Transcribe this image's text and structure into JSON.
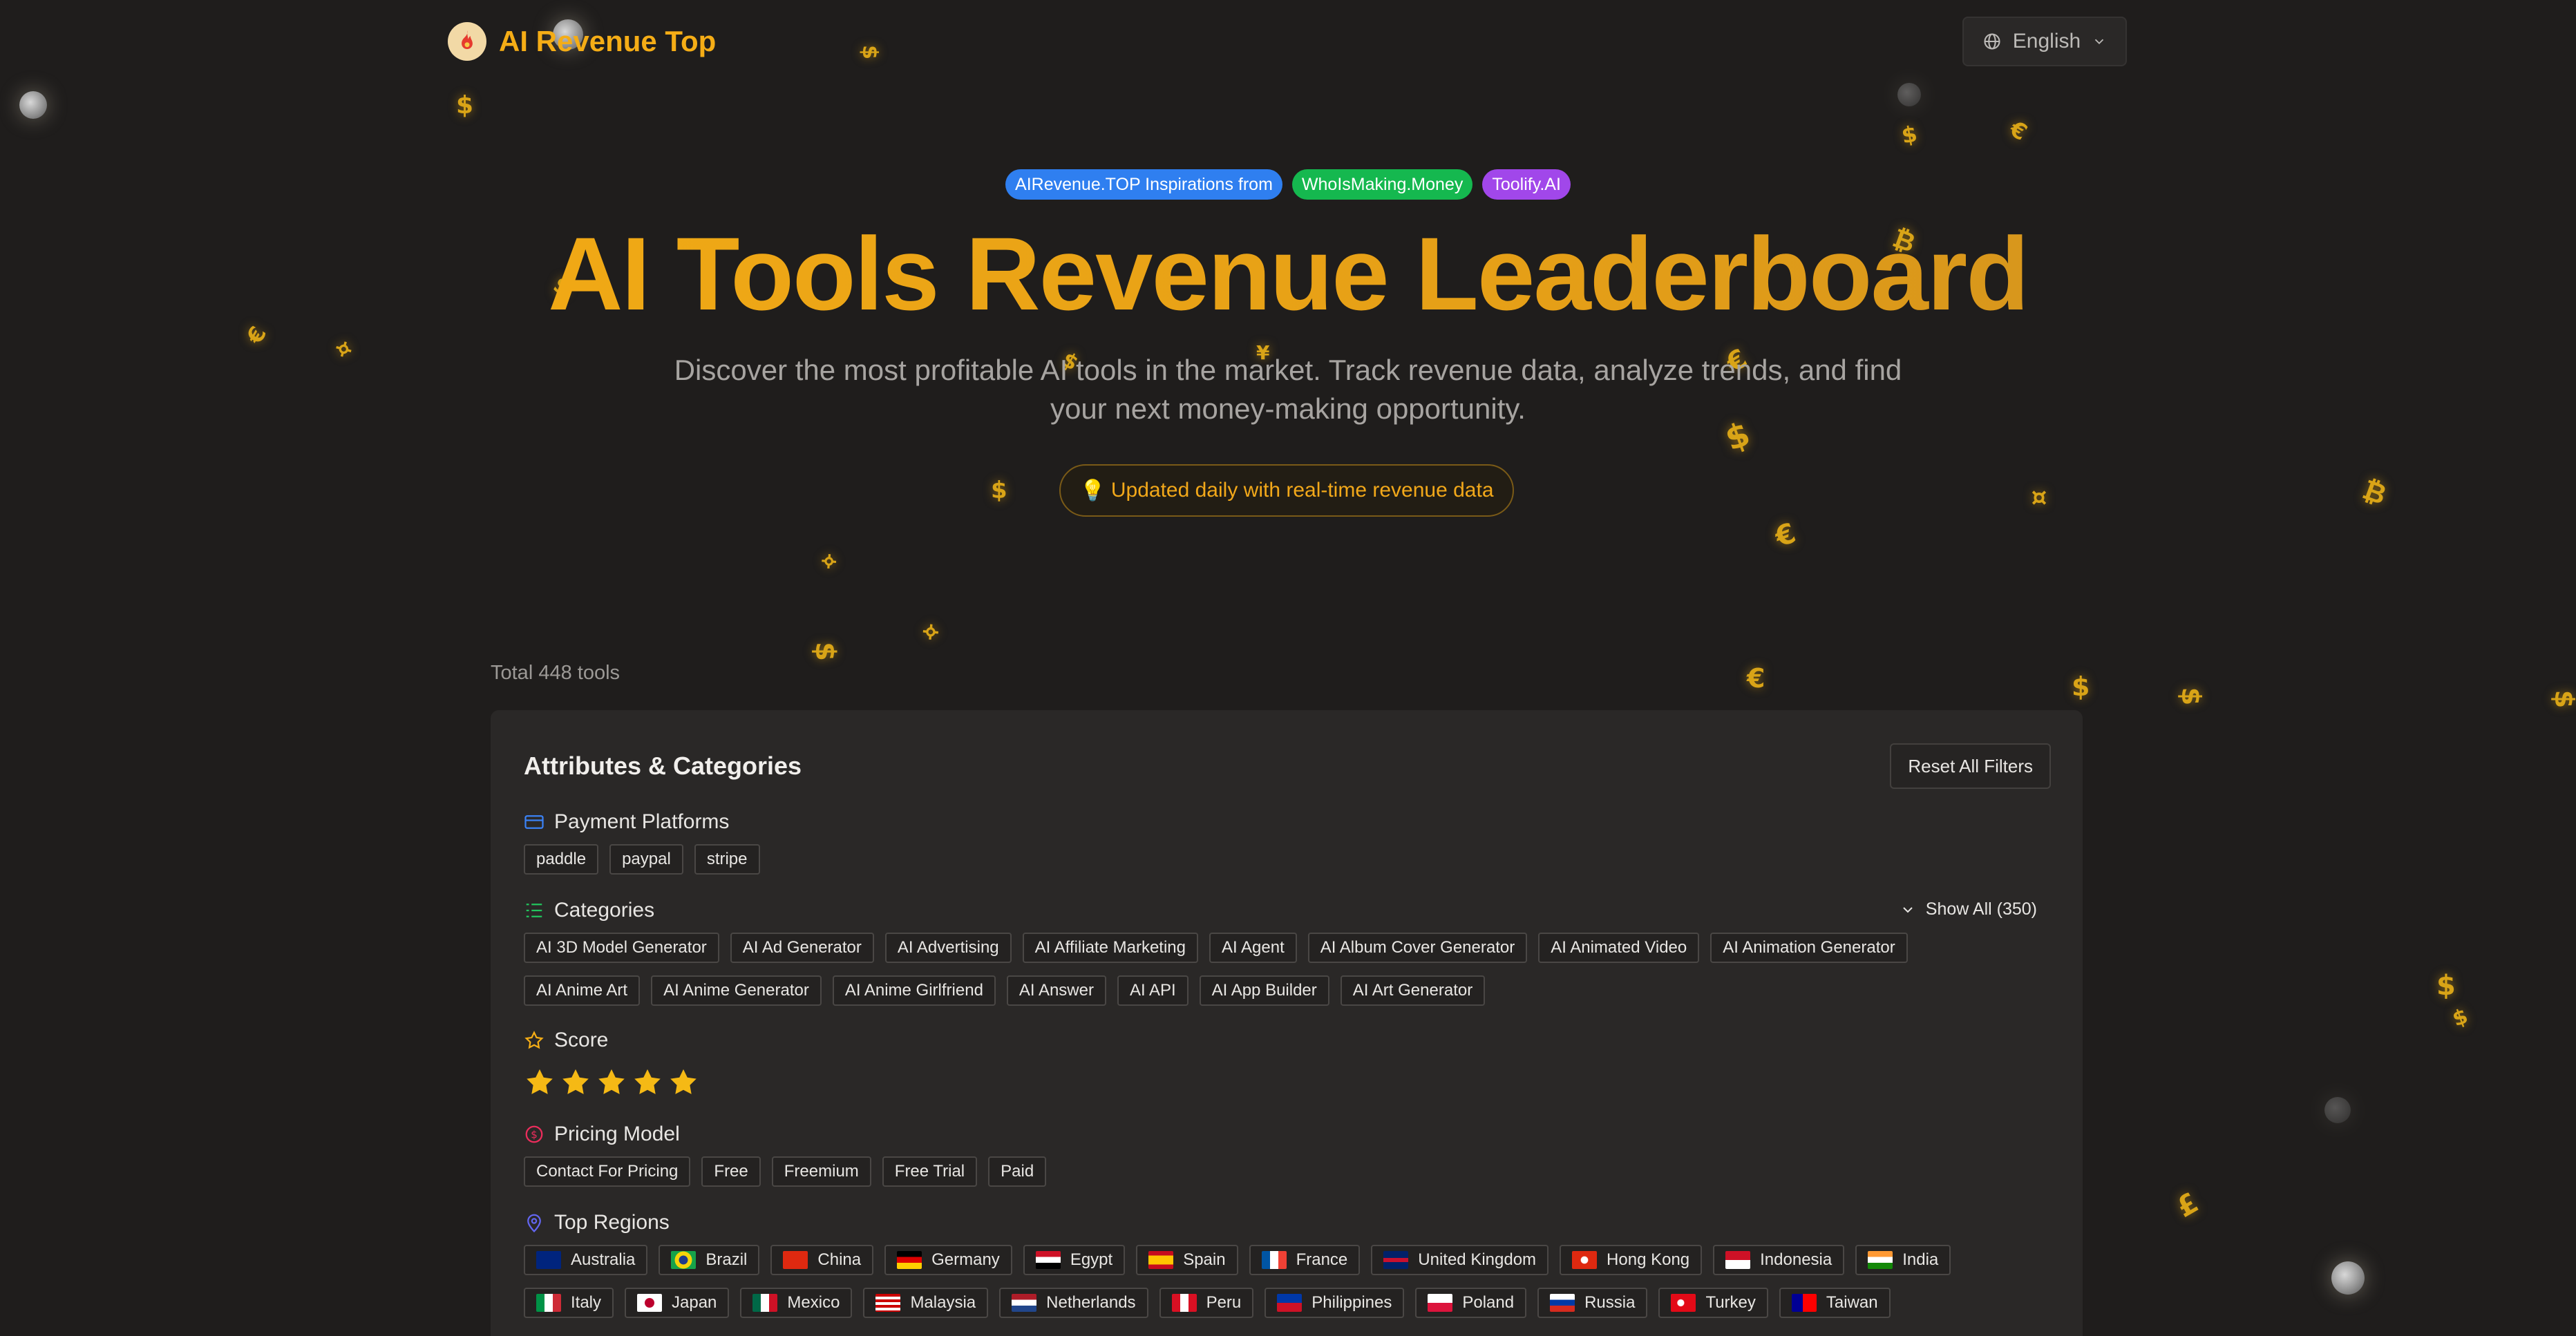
{
  "header": {
    "brand": "AI Revenue Top",
    "language": "English"
  },
  "hero": {
    "badges": [
      "AIRevenue.TOP Inspirations from",
      "WhoIsMaking.Money",
      "Toolify.AI"
    ],
    "title": "AI Tools Revenue Leaderboard",
    "subtitle": "Discover the most profitable AI tools in the market. Track revenue data, analyze trends, and find your next money-making opportunity.",
    "update_note": "Updated daily with real-time revenue data"
  },
  "total": "Total 448 tools",
  "filters": {
    "title": "Attributes & Categories",
    "reset": "Reset All Filters",
    "payment": {
      "title": "Payment Platforms",
      "items": [
        "paddle",
        "paypal",
        "stripe"
      ]
    },
    "categories": {
      "title": "Categories",
      "show_all": "Show All (350)",
      "items": [
        "AI 3D Model Generator",
        "AI Ad Generator",
        "AI Advertising",
        "AI Affiliate Marketing",
        "AI Agent",
        "AI Album Cover Generator",
        "AI Animated Video",
        "AI Animation Generator",
        "AI Anime Art",
        "AI Anime Generator",
        "AI Anime Girlfriend",
        "AI Answer",
        "AI API",
        "AI App Builder",
        "AI Art Generator"
      ]
    },
    "score": {
      "title": "Score",
      "stars": 5
    },
    "pricing": {
      "title": "Pricing Model",
      "items": [
        "Contact For Pricing",
        "Free",
        "Freemium",
        "Free Trial",
        "Paid"
      ]
    },
    "regions": {
      "title": "Top Regions",
      "items": [
        "Australia",
        "Brazil",
        "China",
        "Germany",
        "Egypt",
        "Spain",
        "France",
        "United Kingdom",
        "Hong Kong",
        "Indonesia",
        "India",
        "Italy",
        "Japan",
        "Mexico",
        "Malaysia",
        "Netherlands",
        "Peru",
        "Philippines",
        "Poland",
        "Russia",
        "Turkey",
        "Taiwan"
      ]
    }
  },
  "colors": {
    "accent": "#f5ad16",
    "background": "#1f1d1c",
    "panel": "#2a2827"
  }
}
